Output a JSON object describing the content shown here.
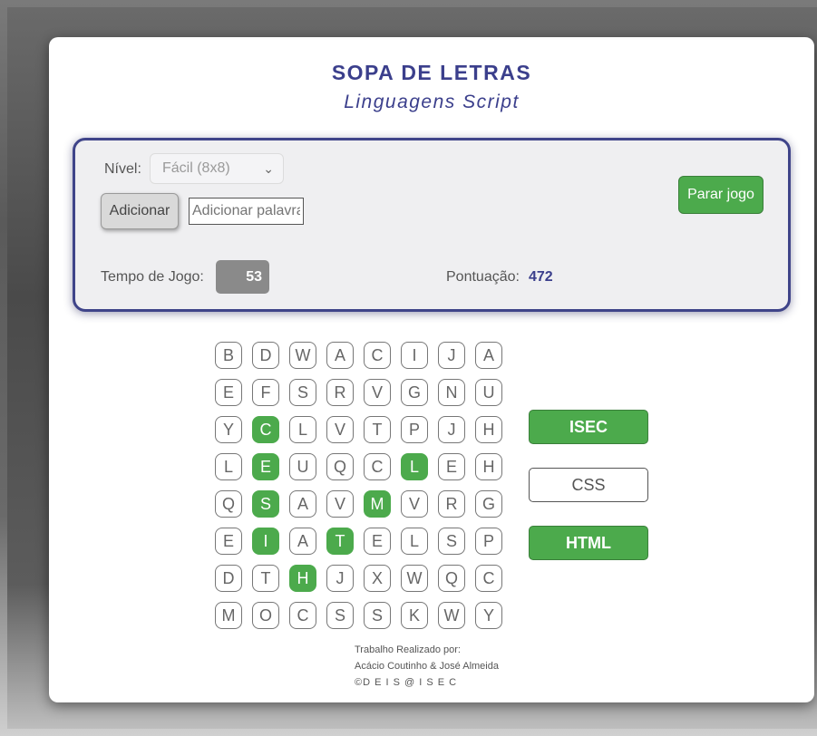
{
  "header": {
    "title": "SOPA DE LETRAS",
    "subtitle": "Linguagens Script"
  },
  "controls": {
    "level_label": "Nível:",
    "level_value": "Fácil (8x8)",
    "add_button": "Adicionar",
    "add_input_placeholder": "Adicionar palavra",
    "stop_button": "Parar jogo",
    "time_label": "Tempo de Jogo:",
    "time_value": "53",
    "score_label": "Pontuação:",
    "score_value": "472"
  },
  "grid": {
    "rows": [
      [
        "B",
        "D",
        "W",
        "A",
        "C",
        "I",
        "J",
        "A"
      ],
      [
        "E",
        "F",
        "S",
        "R",
        "V",
        "G",
        "N",
        "U"
      ],
      [
        "Y",
        "C",
        "L",
        "V",
        "T",
        "P",
        "J",
        "H"
      ],
      [
        "L",
        "E",
        "U",
        "Q",
        "C",
        "L",
        "E",
        "H"
      ],
      [
        "Q",
        "S",
        "A",
        "V",
        "M",
        "V",
        "R",
        "G"
      ],
      [
        "E",
        "I",
        "A",
        "T",
        "E",
        "L",
        "S",
        "P"
      ],
      [
        "D",
        "T",
        "H",
        "J",
        "X",
        "W",
        "Q",
        "C"
      ],
      [
        "M",
        "O",
        "C",
        "S",
        "S",
        "K",
        "W",
        "Y"
      ]
    ],
    "found_cells": [
      [
        2,
        1
      ],
      [
        3,
        1
      ],
      [
        4,
        1
      ],
      [
        5,
        1
      ],
      [
        3,
        5
      ],
      [
        4,
        4
      ],
      [
        5,
        3
      ],
      [
        6,
        2
      ]
    ]
  },
  "words": [
    {
      "text": "ISEC",
      "found": true
    },
    {
      "text": "CSS",
      "found": false
    },
    {
      "text": "HTML",
      "found": true
    }
  ],
  "footer": {
    "line1": "Trabalho Realizado por:",
    "line2": "Acácio Coutinho & José Almeida",
    "line3": "©D E I S @ I S E C"
  },
  "colors": {
    "accent": "#3b3f8c",
    "found": "#4caa4c",
    "panel_border": "#3f4489"
  }
}
